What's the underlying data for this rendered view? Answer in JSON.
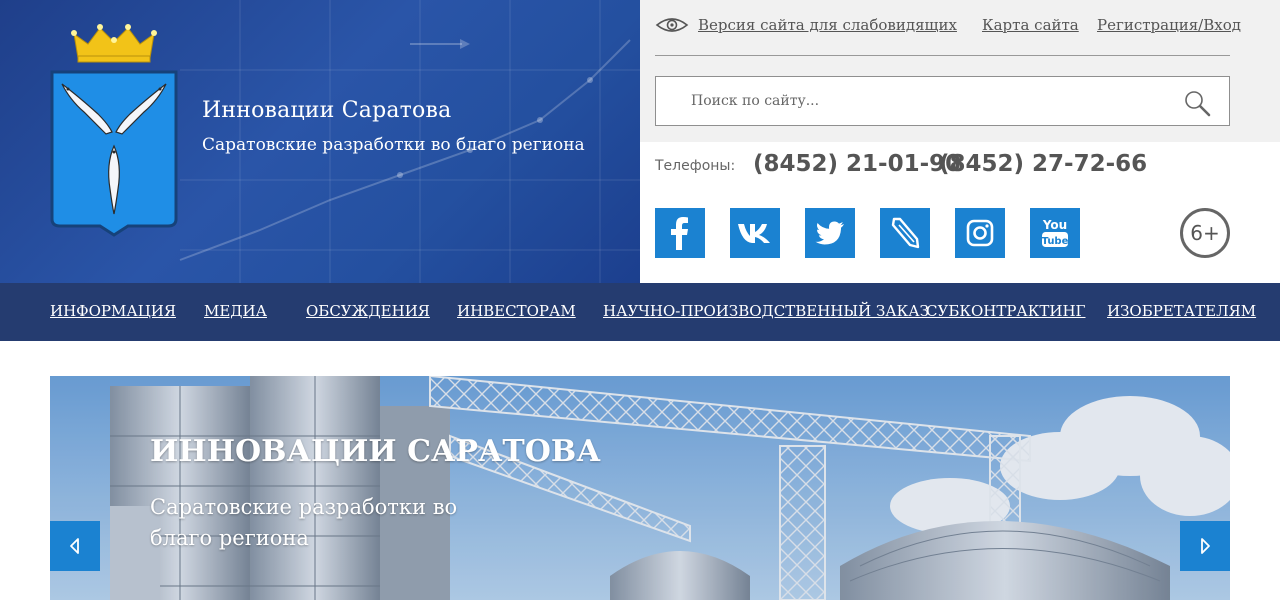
{
  "header": {
    "site_title": "Инновации Саратова",
    "site_subtitle": "Саратовские разработки во благо региона",
    "accessibility_link": "Версия сайта для слабовидящих",
    "sitemap_link": "Карта сайта",
    "auth_link": "Регистрация/Вход",
    "search": {
      "placeholder": "Поиск по сайту..."
    },
    "phones_label": "Телефоны:",
    "phones": [
      "(8452) 21-01-90",
      "(8452) 27-72-66"
    ],
    "social": [
      {
        "name": "facebook",
        "icon": "facebook-icon"
      },
      {
        "name": "vk",
        "icon": "vk-icon"
      },
      {
        "name": "twitter",
        "icon": "twitter-icon"
      },
      {
        "name": "livejournal",
        "icon": "livejournal-icon"
      },
      {
        "name": "instagram",
        "icon": "instagram-icon"
      },
      {
        "name": "youtube",
        "icon": "youtube-icon",
        "text_top": "You",
        "text_bottom": "Tube"
      }
    ],
    "age_rating": "6+"
  },
  "nav": {
    "items": [
      "ИНФОРМАЦИЯ",
      "МЕДИА",
      "ОБСУЖДЕНИЯ",
      "ИНВЕСТОРАМ",
      "НАУЧНО-ПРОИЗВОДСТВЕННЫЙ ЗАКАЗ",
      "СУБКОНТРАКТИНГ",
      "ИЗОБРЕТАТЕЛЯМ"
    ]
  },
  "slider": {
    "title": "ИННОВАЦИИ САРАТОВА",
    "subtitle": "Саратовские разработки во благо региона"
  },
  "colors": {
    "header_blue": "#2a55a8",
    "nav_bg": "#253c70",
    "accent_blue": "#1b82d1",
    "gold": "#f2c318"
  }
}
